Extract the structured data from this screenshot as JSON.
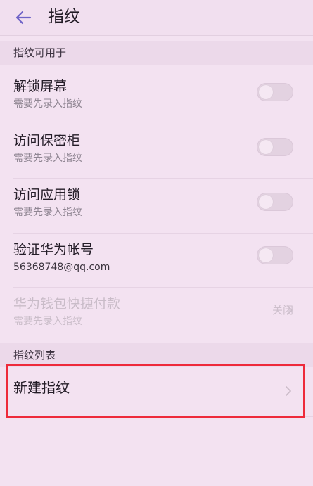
{
  "header": {
    "title": "指纹",
    "back_icon": "arrow-left-icon"
  },
  "sections": {
    "usage_label": "指纹可用于",
    "list_label": "指纹列表"
  },
  "items": [
    {
      "title": "解锁屏幕",
      "subtitle": "需要先录入指纹",
      "toggle_on": false
    },
    {
      "title": "访问保密柜",
      "subtitle": "需要先录入指纹",
      "toggle_on": false
    },
    {
      "title": "访问应用锁",
      "subtitle": "需要先录入指纹",
      "toggle_on": false
    },
    {
      "title": "验证华为帐号",
      "subtitle": "56368748@qq.com",
      "toggle_on": false
    },
    {
      "title": "华为钱包快捷付款",
      "subtitle": "需要先录入指纹",
      "value": "关闭",
      "disabled": true
    }
  ],
  "new_fingerprint": {
    "label": "新建指纹"
  },
  "colors": {
    "accent": "#6f63c7",
    "highlight": "#ee2a3b",
    "background": "#f3e2f1"
  }
}
